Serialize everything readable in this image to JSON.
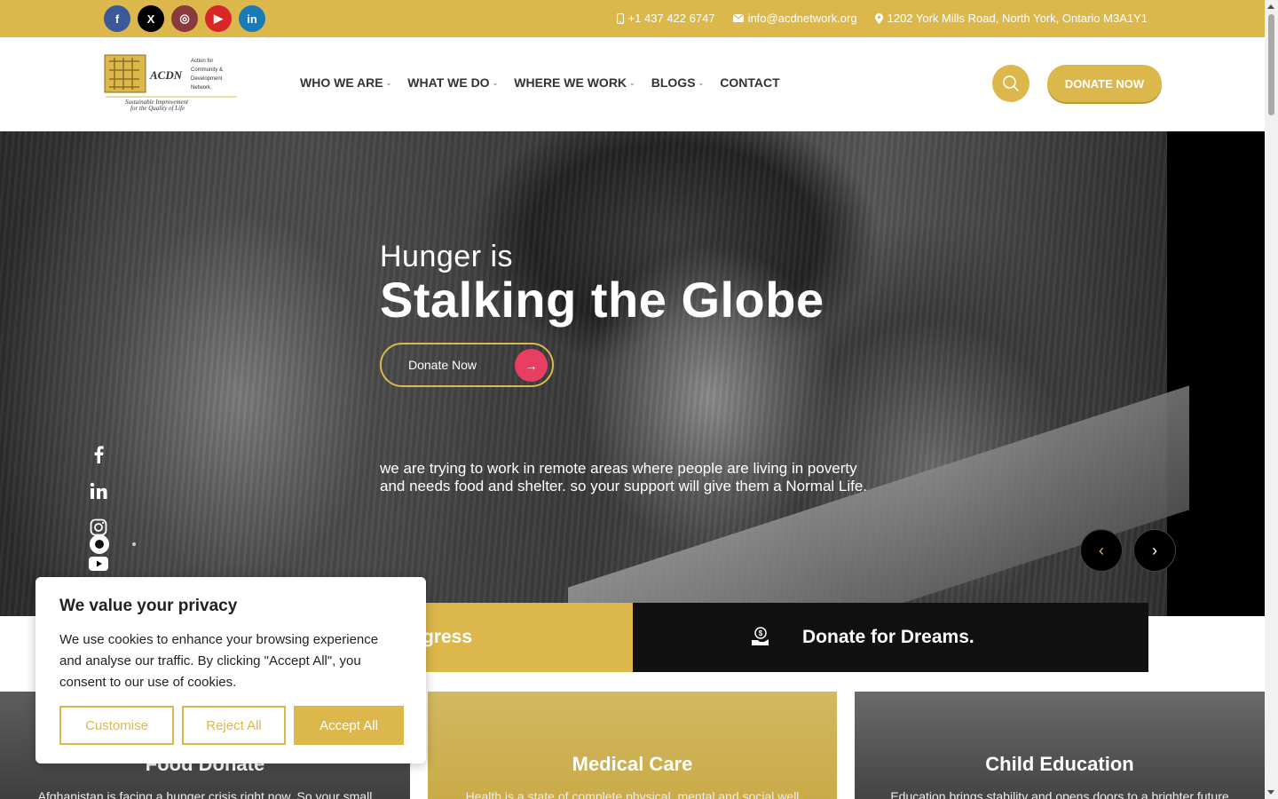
{
  "social_top": [
    {
      "name": "facebook",
      "glyph": "f"
    },
    {
      "name": "x",
      "glyph": "X"
    },
    {
      "name": "instagram",
      "glyph": "◎"
    },
    {
      "name": "youtube",
      "glyph": "▶"
    },
    {
      "name": "linkedin",
      "glyph": "in"
    }
  ],
  "contacts": {
    "phone": "+1 437 422 6747",
    "email": "info@acdnetwork.org",
    "address": "1202 York Mills Road, North York, Ontario M3A1Y1"
  },
  "logo": {
    "abbr": "ACDN",
    "line1": "Action for",
    "line2": "Community &",
    "line3": "Development",
    "line4": "Network",
    "tagline1": "Sustainable Improvement",
    "tagline2": "for the Quality of Life"
  },
  "nav": [
    {
      "label": "WHO WE ARE",
      "dropdown": true
    },
    {
      "label": "WHAT WE DO",
      "dropdown": true
    },
    {
      "label": "WHERE WE WORK",
      "dropdown": true
    },
    {
      "label": "BLOGS",
      "dropdown": true
    },
    {
      "label": "CONTACT",
      "dropdown": false
    }
  ],
  "header": {
    "donate_label": "DONATE NOW",
    "search_icon": "search-icon"
  },
  "hero": {
    "subtitle": "Hunger is",
    "title": "Stalking the Globe",
    "cta_label": "Donate Now",
    "cta_arrow": "→",
    "description": "we are trying to work in remote areas where people are living in poverty and needs food and shelter. so your support will give them a Normal Life.",
    "prev_arrow": "‹",
    "next_arrow": "›"
  },
  "strip": {
    "gold_text": "gress",
    "dark_text": "Donate for Dreams."
  },
  "cards": [
    {
      "title": "Food Donate",
      "text": "Afghanistan is facing a hunger crisis right now. So your small"
    },
    {
      "title": "Medical Care",
      "text": "Health is a state of complete physical, mental and social well"
    },
    {
      "title": "Child Education",
      "text": "Education brings stability and opens doors to a brighter future"
    }
  ],
  "cookie": {
    "title": "We value your privacy",
    "body": "We use cookies to enhance your browsing experience and analyse our traffic. By clicking \"Accept All\", you consent to our use of cookies.",
    "customise": "Customise",
    "reject": "Reject All",
    "accept": "Accept All"
  },
  "colors": {
    "accent": "#dcb84c",
    "dark": "#111111",
    "pink": "#e83e60"
  }
}
